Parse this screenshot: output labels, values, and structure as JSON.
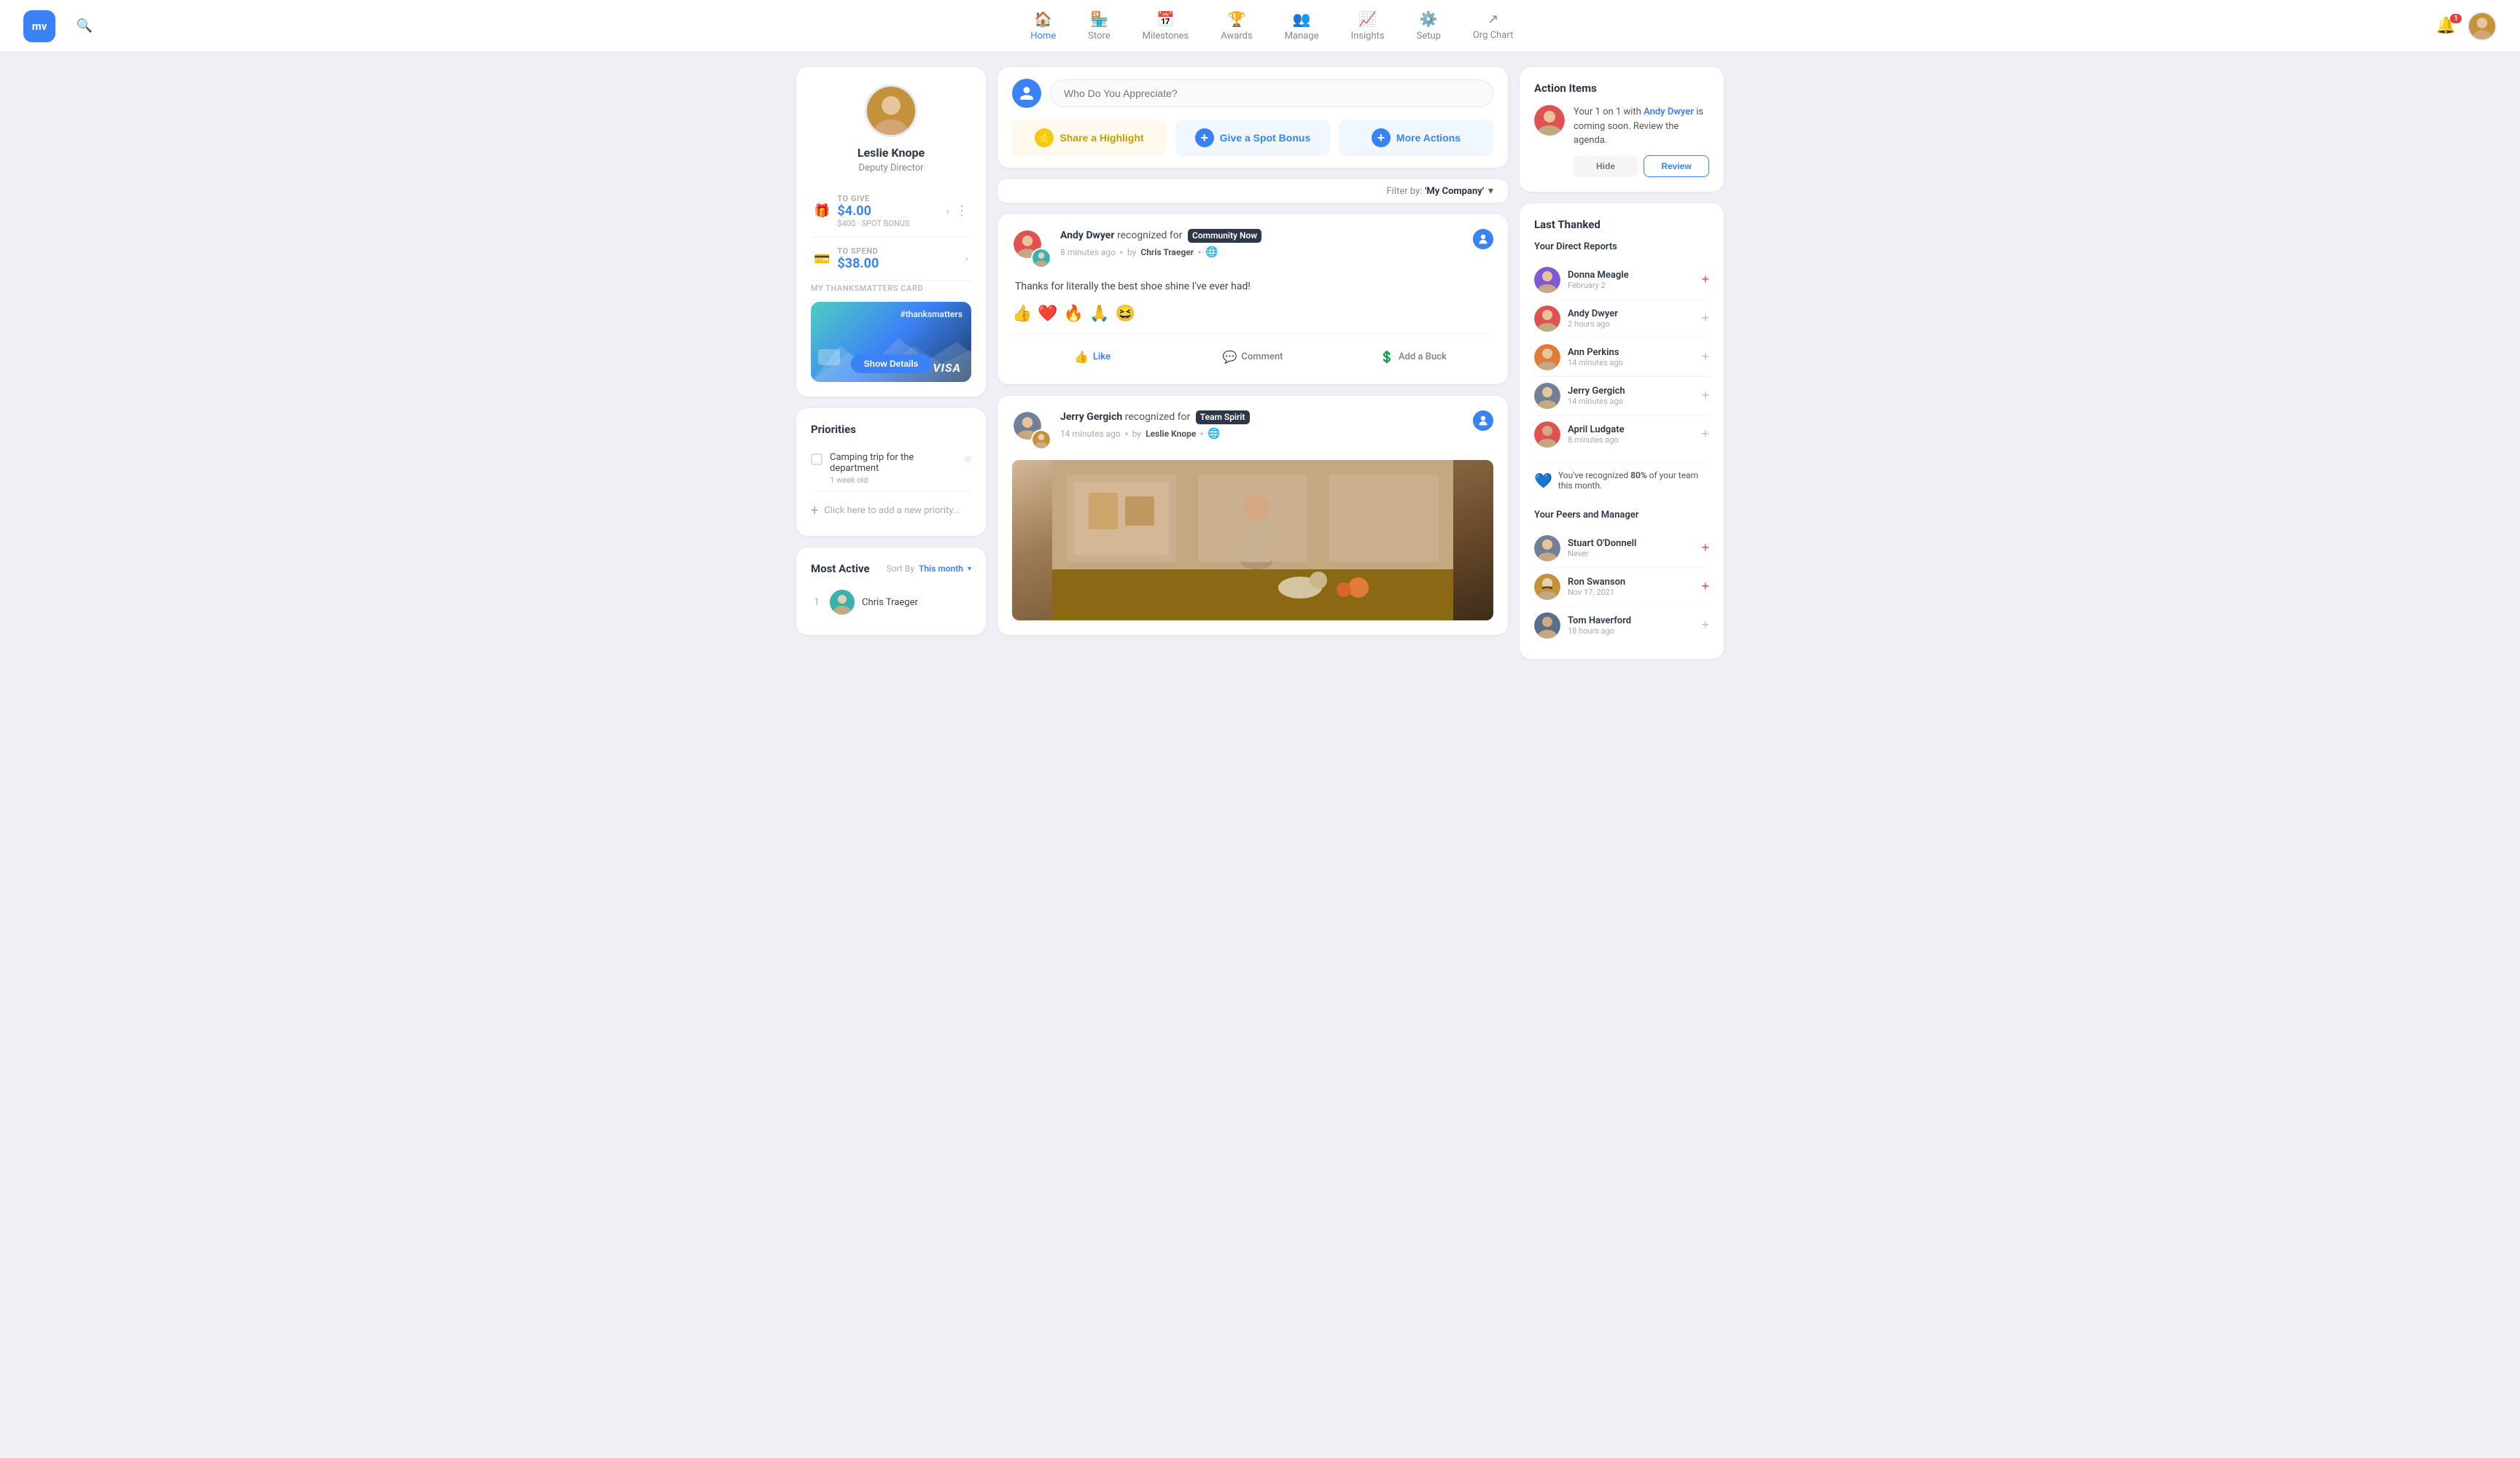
{
  "app": {
    "logo_initials": "mv",
    "notification_count": "1"
  },
  "nav": {
    "links": [
      {
        "id": "home",
        "label": "Home",
        "icon": "🏠",
        "active": true
      },
      {
        "id": "store",
        "label": "Store",
        "icon": "🏪",
        "active": false
      },
      {
        "id": "milestones",
        "label": "Milestones",
        "icon": "📅",
        "active": false
      },
      {
        "id": "awards",
        "label": "Awards",
        "icon": "🏆",
        "active": false
      },
      {
        "id": "manage",
        "label": "Manage",
        "icon": "👥",
        "active": false
      },
      {
        "id": "insights",
        "label": "Insights",
        "icon": "📈",
        "active": false
      },
      {
        "id": "setup",
        "label": "Setup",
        "icon": "⚙️",
        "active": false
      },
      {
        "id": "org-chart",
        "label": "Org Chart",
        "icon": "↗",
        "active": false
      }
    ]
  },
  "profile": {
    "name": "Leslie Knope",
    "title": "Deputy Director",
    "to_give_label": "TO GIVE",
    "to_give_amount": "$4.00",
    "spot_bonus_label": "$400 · SPOT BONUS",
    "to_spend_label": "TO SPEND",
    "to_spend_amount": "$38.00",
    "thanks_card_label": "My ThanksMatters Card",
    "thanks_card_hashtag": "#thanksmatters",
    "show_details_label": "Show Details",
    "visa_label": "VISA"
  },
  "priorities": {
    "section_title": "Priorities",
    "items": [
      {
        "text": "Camping trip for the department",
        "age": "1 week old"
      }
    ],
    "add_label": "Click here to add a new priority..."
  },
  "most_active": {
    "section_title": "Most Active",
    "sort_label": "Sort By",
    "sort_value": "This month",
    "items": [
      {
        "rank": "1",
        "name": "Chris Traeger"
      }
    ]
  },
  "appreciate": {
    "placeholder": "Who Do You Appreciate?",
    "btn_highlight": "Share a Highlight",
    "btn_bonus": "Give a Spot Bonus",
    "btn_more": "More Actions"
  },
  "filter": {
    "label": "Filter by:",
    "value": "'My Company'",
    "aria": "filter-dropdown"
  },
  "feed": [
    {
      "id": "post-1",
      "actor": "Andy Dwyer",
      "action": "recognized for",
      "badge": "Community Now",
      "time": "8 minutes ago",
      "by_label": "by",
      "by_name": "Chris Traeger",
      "message": "Thanks for literally the best shoe shine I've ever had!",
      "reactions": [
        "👍",
        "❤️",
        "🔥",
        "🙏",
        "😆"
      ],
      "like_label": "Like",
      "comment_label": "Comment",
      "buck_label": "Add a Buck"
    },
    {
      "id": "post-2",
      "actor": "Jerry Gergich",
      "action": "recognized for",
      "badge": "Team Spirit",
      "time": "14 minutes ago",
      "by_label": "by",
      "by_name": "Leslie Knope",
      "message": "",
      "has_image": true
    }
  ],
  "action_items": {
    "section_title": "Action Items",
    "text_before": "Your 1 on 1 with ",
    "link_name": "Andy Dwyer",
    "text_after": " is coming soon. Review the agenda.",
    "hide_label": "Hide",
    "review_label": "Review"
  },
  "last_thanked": {
    "section_title": "Last Thanked",
    "direct_reports_title": "Your Direct Reports",
    "direct_reports": [
      {
        "name": "Donna Meagle",
        "time": "February 2",
        "add_active": true
      },
      {
        "name": "Andy Dwyer",
        "time": "2 hours ago",
        "add_active": false
      },
      {
        "name": "Ann Perkins",
        "time": "14 minutes ago",
        "add_active": false
      },
      {
        "name": "Jerry Gergich",
        "time": "14 minutes ago",
        "add_active": false
      },
      {
        "name": "April Ludgate",
        "time": "8 minutes ago",
        "add_active": false
      }
    ],
    "recognition_note": "You've recognized ",
    "recognition_pct": "80%",
    "recognition_note2": " of your team this month.",
    "peers_title": "Your Peers and Manager",
    "peers": [
      {
        "name": "Stuart O'Donnell",
        "time": "Never",
        "add_active": true
      },
      {
        "name": "Ron Swanson",
        "time": "Nov 17, 2021",
        "add_active": true
      },
      {
        "name": "Tom Haverford",
        "time": "18 hours ago",
        "add_active": false
      }
    ]
  }
}
